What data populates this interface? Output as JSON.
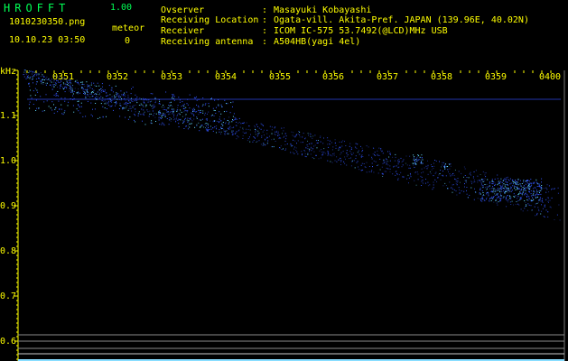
{
  "header": {
    "app_name": "HROFFT",
    "version": "1.00",
    "filename": "1010230350.png",
    "datetime": "10.10.23 03:50",
    "meteor_label": "meteor",
    "meteor_count": "0",
    "info": [
      {
        "label": "Ovserver",
        "value": "Masayuki Kobayashi"
      },
      {
        "label": "Receiving Location",
        "value": "Ogata-vill. Akita-Pref. JAPAN (139.96E, 40.02N)"
      },
      {
        "label": "Receiver",
        "value": "ICOM IC-575 53.7492(@LCD)MHz USB"
      },
      {
        "label": "Receiving antenna",
        "value": "A504HB(yagi 4el)"
      }
    ]
  },
  "spectrogram": {
    "y_unit": "kHz",
    "y_ticks": [
      "1.1",
      "1.0",
      "0.9",
      "0.8",
      "0.7",
      "0.6"
    ],
    "x_ticks": [
      "0351",
      "0352",
      "0353",
      "0354",
      "0355",
      "0356",
      "0357",
      "0358",
      "0359",
      "0400"
    ],
    "colors": {
      "text": "#ffff00",
      "app": "#00ff55",
      "signal": "#3355ff",
      "hot": "#66ddff"
    }
  }
}
